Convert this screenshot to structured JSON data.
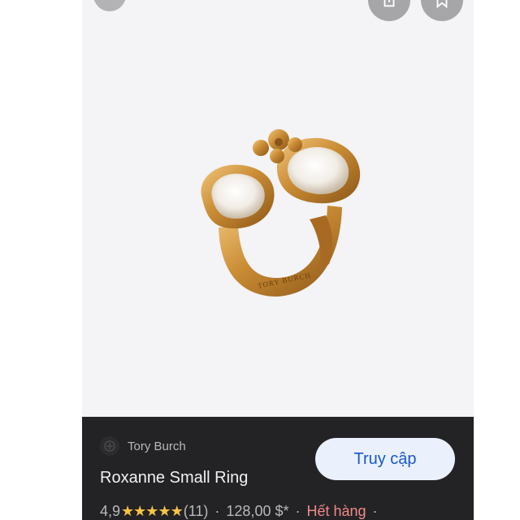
{
  "product": {
    "brand": "Tory Burch",
    "title": "Roxanne Small Ring",
    "rating": "4,9",
    "stars": "★★★★★",
    "reviews": "(11)",
    "price": "128,00 $*",
    "availability": "Hết hàng",
    "separator": "·"
  },
  "actions": {
    "visit_label": "Truy cập"
  },
  "icons": {
    "close": "close-icon",
    "share": "share-icon",
    "save": "bookmark-icon",
    "brand_logo": "tory-burch-logo-icon"
  },
  "colors": {
    "panel_bg": "#232325",
    "button_bg": "#eaf1fd",
    "button_text": "#1a56c8",
    "star": "#f6c445",
    "out_of_stock": "#f08a8a"
  }
}
